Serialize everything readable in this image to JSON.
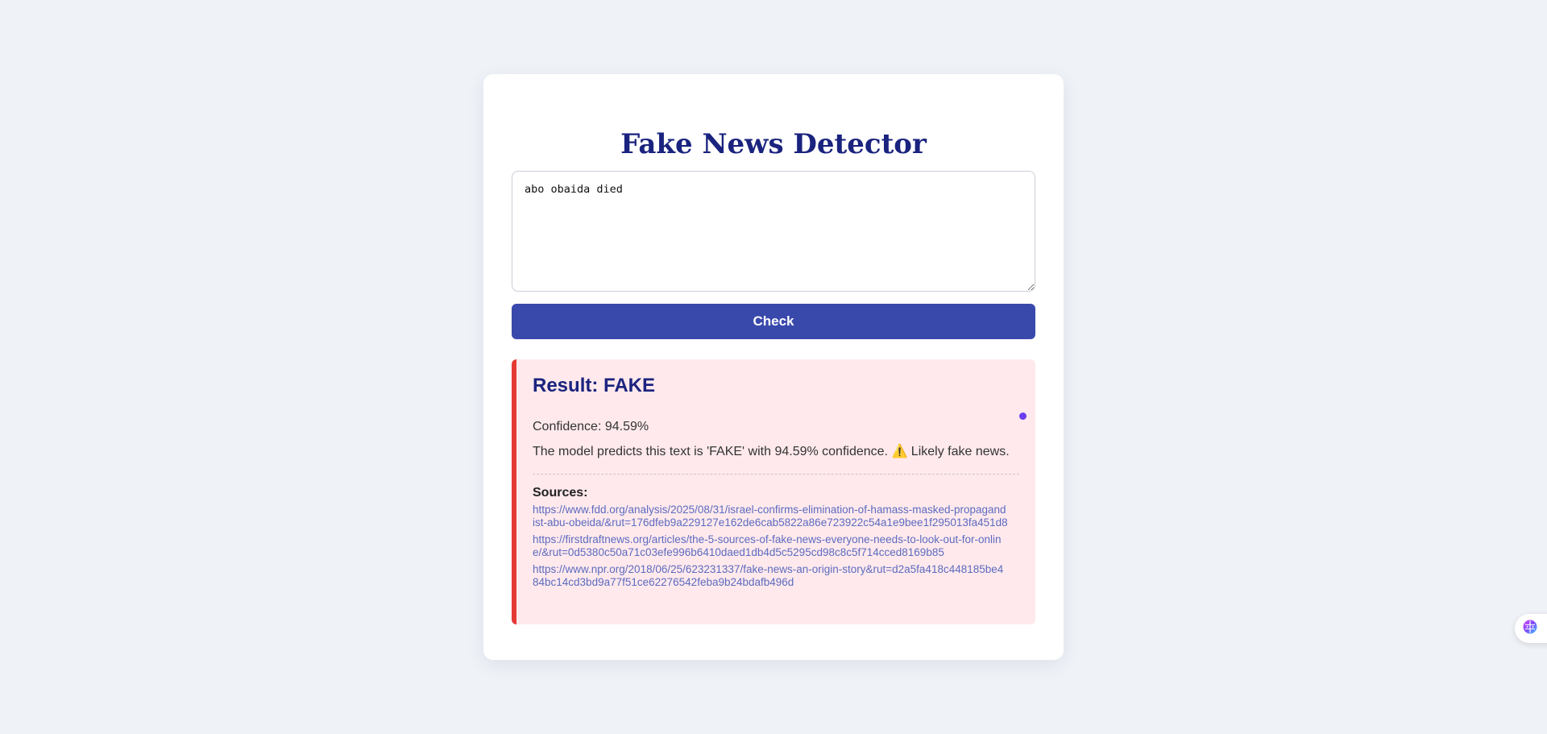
{
  "app": {
    "title": "Fake News Detector"
  },
  "input": {
    "value": "abo obaida died"
  },
  "check_button": {
    "label": "Check"
  },
  "result": {
    "title": "Result: FAKE",
    "confidence": "Confidence: 94.59%",
    "explanation": "The model predicts this text is 'FAKE' with 94.59% confidence. ⚠️ Likely fake news.",
    "accent_color": "#e53935",
    "background_color": "#ffe9ec",
    "sources_heading": "Sources:",
    "sources": [
      "https://www.fdd.org/analysis/2025/08/31/israel-confirms-elimination-of-hamass-masked-propagandist-abu-obeida/&rut=176dfeb9a229127e162de6cab5822a86e723922c54a1e9bee1f295013fa451d8",
      "https://firstdraftnews.org/articles/the-5-sources-of-fake-news-everyone-needs-to-look-out-for-online/&rut=0d5380c50a71c03efe996b6410daed1db4d5c5295cd98c8c5f714cced8169b85",
      "https://www.npr.org/2018/06/25/623231337/fake-news-an-origin-story&rut=d2a5fa418c448185be484bc14cd3bd9a77f51ce62276542feba9b24bdafb496d"
    ]
  },
  "widget": {
    "icon": "brain-icon"
  },
  "colors": {
    "page_background": "#eff2f7",
    "title": "#1a237e",
    "button": "#3949ab",
    "link": "#5c6bc0"
  }
}
